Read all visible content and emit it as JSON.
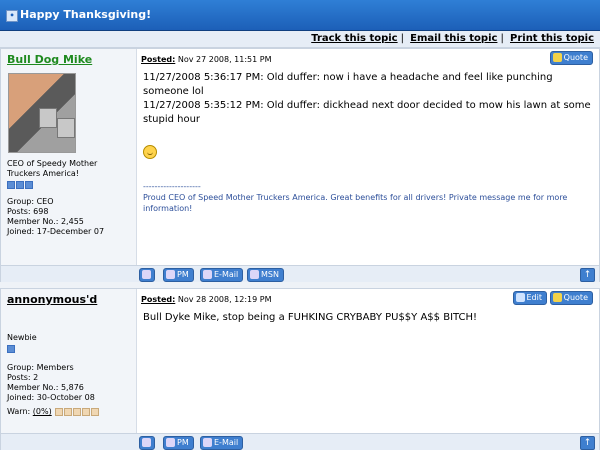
{
  "topic": {
    "title": "Happy Thanksgiving!"
  },
  "toolbar": {
    "links": [
      "Track this topic",
      "Email this topic",
      "Print this topic"
    ]
  },
  "posts": [
    {
      "author": "Bull Dog Mike",
      "title": "CEO of Speedy Mother Truckers America!",
      "group": "Group: CEO",
      "posts": "Posts: 698",
      "member_no": "Member No.: 2,455",
      "joined": "Joined: 17-December 07",
      "posted_label": "Posted:",
      "posted_at": "Nov 27 2008, 11:51 PM",
      "body": [
        "11/27/2008 5:36:17 PM: Old duffer: now i have a headache and feel like punching someone lol",
        "11/27/2008 5:35:12 PM: Old duffer: dickhead next door decided to mow his lawn at some stupid hour"
      ],
      "signature_rule": "--------------------",
      "signature": "Proud CEO of Speed Mother Truckers America. Great benefits for all drivers! Private message me for more information!",
      "buttons": {
        "quote": "Quote"
      },
      "footer": {
        "pm": "PM",
        "email": "E-Mail",
        "msn": "MSN"
      }
    },
    {
      "author": "annonymous'd",
      "title": "Newbie",
      "group": "Group: Members",
      "posts": "Posts: 2",
      "member_no": "Member No.: 5,876",
      "joined": "Joined: 30-October 08",
      "warn_label": "Warn:",
      "warn_value": "(0%)",
      "posted_label": "Posted:",
      "posted_at": "Nov 28 2008, 12:19 PM",
      "body": [
        "Bull Dyke Mike, stop being a FUHKING CRYBABY PU$$Y A$$ BITCH!"
      ],
      "buttons": {
        "edit": "Edit",
        "quote": "Quote"
      },
      "footer": {
        "pm": "PM",
        "email": "E-Mail"
      }
    }
  ]
}
